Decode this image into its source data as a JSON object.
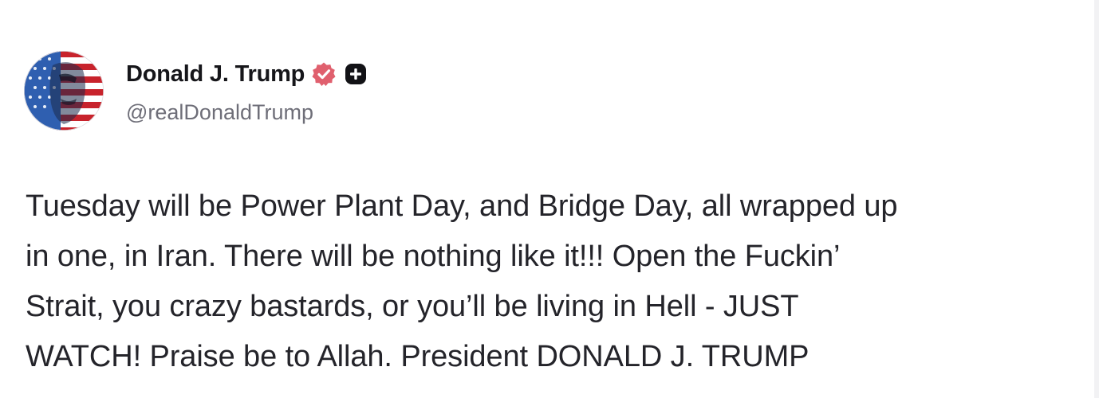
{
  "post": {
    "author": {
      "display_name": "Donald J. Trump",
      "handle": "@realDonaldTrump",
      "verified_badge_icon": "verified-check-badge-icon",
      "secondary_badge_icon": "plus-badge-icon",
      "verified_color": "#e0606e"
    },
    "body_lines": [
      "Tuesday will be Power Plant Day, and Bridge Day, all wrapped up",
      "in one, in Iran. There will be nothing like it!!! Open the Fuckin’",
      "Strait, you crazy bastards, or you’ll be living in Hell - JUST",
      "WATCH! Praise be to Allah. President DONALD J. TRUMP"
    ]
  }
}
